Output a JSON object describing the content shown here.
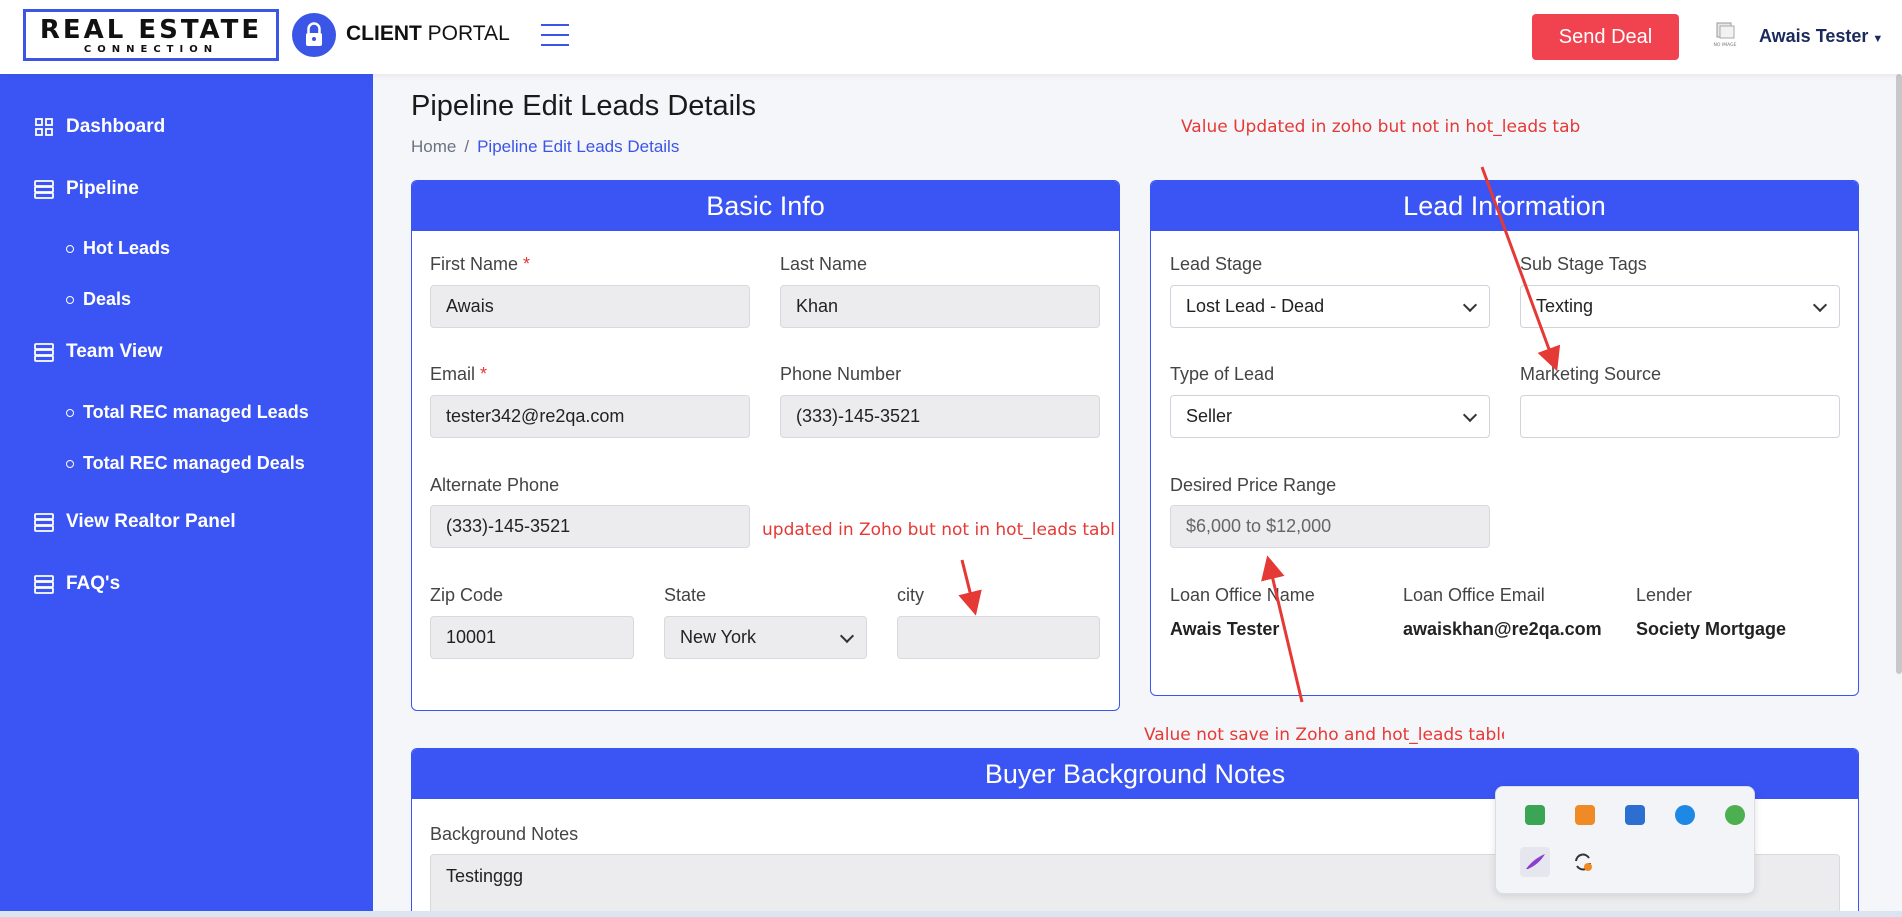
{
  "header": {
    "logo_main": "REAL ESTATE",
    "logo_sub": "CONNECTION",
    "portal_bold": "CLIENT",
    "portal_rest": " PORTAL",
    "send_deal": "Send Deal",
    "noimage_label": "NO IMAGE",
    "user_name": "Awais Tester"
  },
  "sidebar": {
    "items": [
      {
        "label": "Dashboard",
        "icon": "grid-icon"
      },
      {
        "label": "Pipeline",
        "icon": "list-icon"
      },
      {
        "label": "Hot Leads"
      },
      {
        "label": "Deals"
      },
      {
        "label": "Team View",
        "icon": "list-icon"
      },
      {
        "label": "Total REC managed Leads"
      },
      {
        "label": "Total REC managed Deals"
      },
      {
        "label": "View Realtor Panel",
        "icon": "list-icon"
      },
      {
        "label": "FAQ's",
        "icon": "list-icon"
      }
    ]
  },
  "page": {
    "title": "Pipeline Edit Leads Details",
    "breadcrumb": [
      "Home",
      "Pipeline Edit Leads Details"
    ]
  },
  "basic_info": {
    "title": "Basic Info",
    "first_name_label": "First Name",
    "first_name": "Awais",
    "last_name_label": "Last Name",
    "last_name": "Khan",
    "email_label": "Email",
    "email": "tester342@re2qa.com",
    "phone_label": "Phone Number",
    "phone": "(333)-145-3521",
    "alt_phone_label": "Alternate Phone",
    "alt_phone": "(333)-145-3521",
    "zip_label": "Zip Code",
    "zip": "10001",
    "state_label": "State",
    "state": "New York",
    "city_label": "city",
    "city": "",
    "required_mark": "*"
  },
  "lead_info": {
    "title": "Lead Information",
    "lead_stage_label": "Lead Stage",
    "lead_stage": "Lost Lead - Dead",
    "sub_stage_label": "Sub Stage Tags",
    "sub_stage": "Texting",
    "type_label": "Type of Lead",
    "type": "Seller",
    "marketing_label": "Marketing Source",
    "marketing": "",
    "price_label": "Desired Price Range",
    "price": "$6,000 to $12,000",
    "loan_name_label": "Loan Office Name",
    "loan_name": "Awais Tester",
    "loan_email_label": "Loan Office Email",
    "loan_email": "awaiskhan@re2qa.com",
    "lender_label": "Lender",
    "lender": "Society Mortgage"
  },
  "buyer_notes": {
    "title": "Buyer Background Notes",
    "label": "Background Notes",
    "value": "Testinggg"
  },
  "annotations": {
    "top": "Value Updated in zoho but not in hot_leads tab",
    "middle": "updated in Zoho but not in hot_leads tabl",
    "bottom": "Value not save in Zoho and hot_leads table"
  },
  "colors": {
    "primary": "#3b55f5",
    "send_deal": "#f0424f",
    "annotation": "#e53935"
  }
}
